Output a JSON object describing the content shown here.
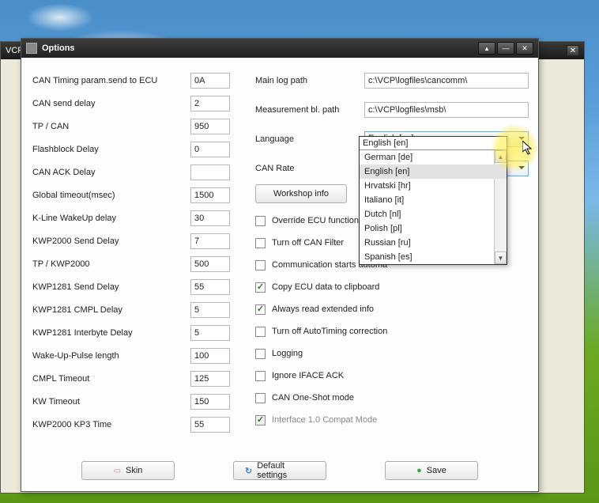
{
  "bgwin": {
    "title": "VCP"
  },
  "window": {
    "title": "Options"
  },
  "left": [
    {
      "label": "CAN Timing param.send to ECU",
      "val": "0A"
    },
    {
      "label": "CAN send delay",
      "val": "2"
    },
    {
      "label": "TP / CAN",
      "val": "950"
    },
    {
      "label": "Flashblock Delay",
      "val": "0"
    },
    {
      "label": "CAN ACK Delay",
      "val": ""
    },
    {
      "label": "Global timeout(msec)",
      "val": "1500"
    },
    {
      "label": "K-Line WakeUp delay",
      "val": "30"
    },
    {
      "label": "KWP2000 Send Delay",
      "val": "7"
    },
    {
      "label": "TP / KWP2000",
      "val": "500"
    },
    {
      "label": "KWP1281 Send Delay",
      "val": "55"
    },
    {
      "label": "KWP1281 CMPL Delay",
      "val": "5"
    },
    {
      "label": "KWP1281 Interbyte Delay",
      "val": "5"
    },
    {
      "label": "Wake-Up-Pulse length",
      "val": "100"
    },
    {
      "label": "CMPL Timeout",
      "val": "125"
    },
    {
      "label": "KW Timeout",
      "val": "150"
    },
    {
      "label": "KWP2000 KP3 Time",
      "val": "55"
    }
  ],
  "right": {
    "mainlog_label": "Main log path",
    "mainlog_value": "c:\\VCP\\logfiles\\cancomm\\",
    "meas_label": "Measurement bl. path",
    "meas_value": "c:\\VCP\\logfiles\\msb\\",
    "lang_label": "Language",
    "lang_value": "English [en]",
    "canrate_label": "CAN Rate",
    "canrate_value": "",
    "workshop_btn": "Workshop info"
  },
  "dropdown": {
    "selected": "English [en]",
    "options": [
      "German [de]",
      "English [en]",
      "Hrvatski [hr]",
      "Italiano [it]",
      "Dutch [nl]",
      "Polish [pl]",
      "Russian [ru]",
      "Spanish [es]"
    ],
    "highlighted": "English [en]"
  },
  "checkboxes": [
    {
      "label": "Override ECU functions",
      "checked": false,
      "disabled": false
    },
    {
      "label": "Turn off CAN Filter",
      "checked": false,
      "disabled": false
    },
    {
      "label": "Communication starts automatically",
      "checked": false,
      "disabled": false,
      "cut": "Communication starts automa"
    },
    {
      "label": "Copy ECU data to clipboard",
      "checked": true,
      "disabled": false
    },
    {
      "label": "Always read extended info",
      "checked": true,
      "disabled": false
    },
    {
      "label": "Turn off AutoTiming correction",
      "checked": false,
      "disabled": false
    },
    {
      "label": "Logging",
      "checked": false,
      "disabled": false
    },
    {
      "label": "Ignore IFACE ACK",
      "checked": false,
      "disabled": false
    },
    {
      "label": "CAN One-Shot mode",
      "checked": false,
      "disabled": false
    },
    {
      "label": "Interface 1.0 Compat Mode",
      "checked": true,
      "disabled": true
    }
  ],
  "footer": {
    "skin": "Skin",
    "defaults": "Default settings",
    "save": "Save"
  }
}
